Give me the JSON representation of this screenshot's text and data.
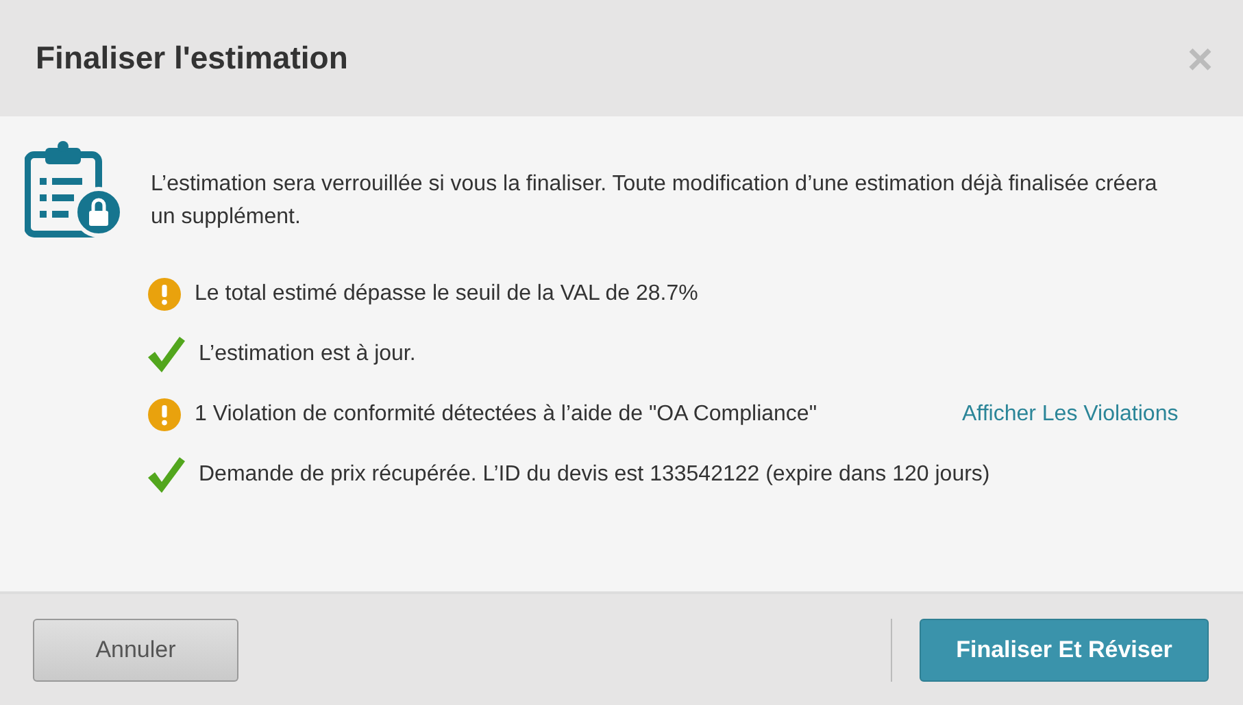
{
  "dialog": {
    "title": "Finaliser l'estimation",
    "close": "×"
  },
  "message": "L’estimation sera verrouillée si vous la finaliser. Toute modification d’une estimation déjà finalisée créera un supplément.",
  "checks": [
    {
      "kind": "warning",
      "text": "Le total estimé dépasse le seuil de la VAL de 28.7%"
    },
    {
      "kind": "success",
      "text": "L’estimation est à jour."
    },
    {
      "kind": "warning",
      "text": "1 Violation de conformité détectées à l’aide de \"OA Compliance\"",
      "link": "Afficher Les Violations"
    },
    {
      "kind": "success",
      "text": "Demande de prix récupérée. L’ID du devis est 133542122 (expire dans 120 jours)"
    }
  ],
  "buttons": {
    "cancel": "Annuler",
    "confirm": "Finaliser Et Réviser"
  }
}
